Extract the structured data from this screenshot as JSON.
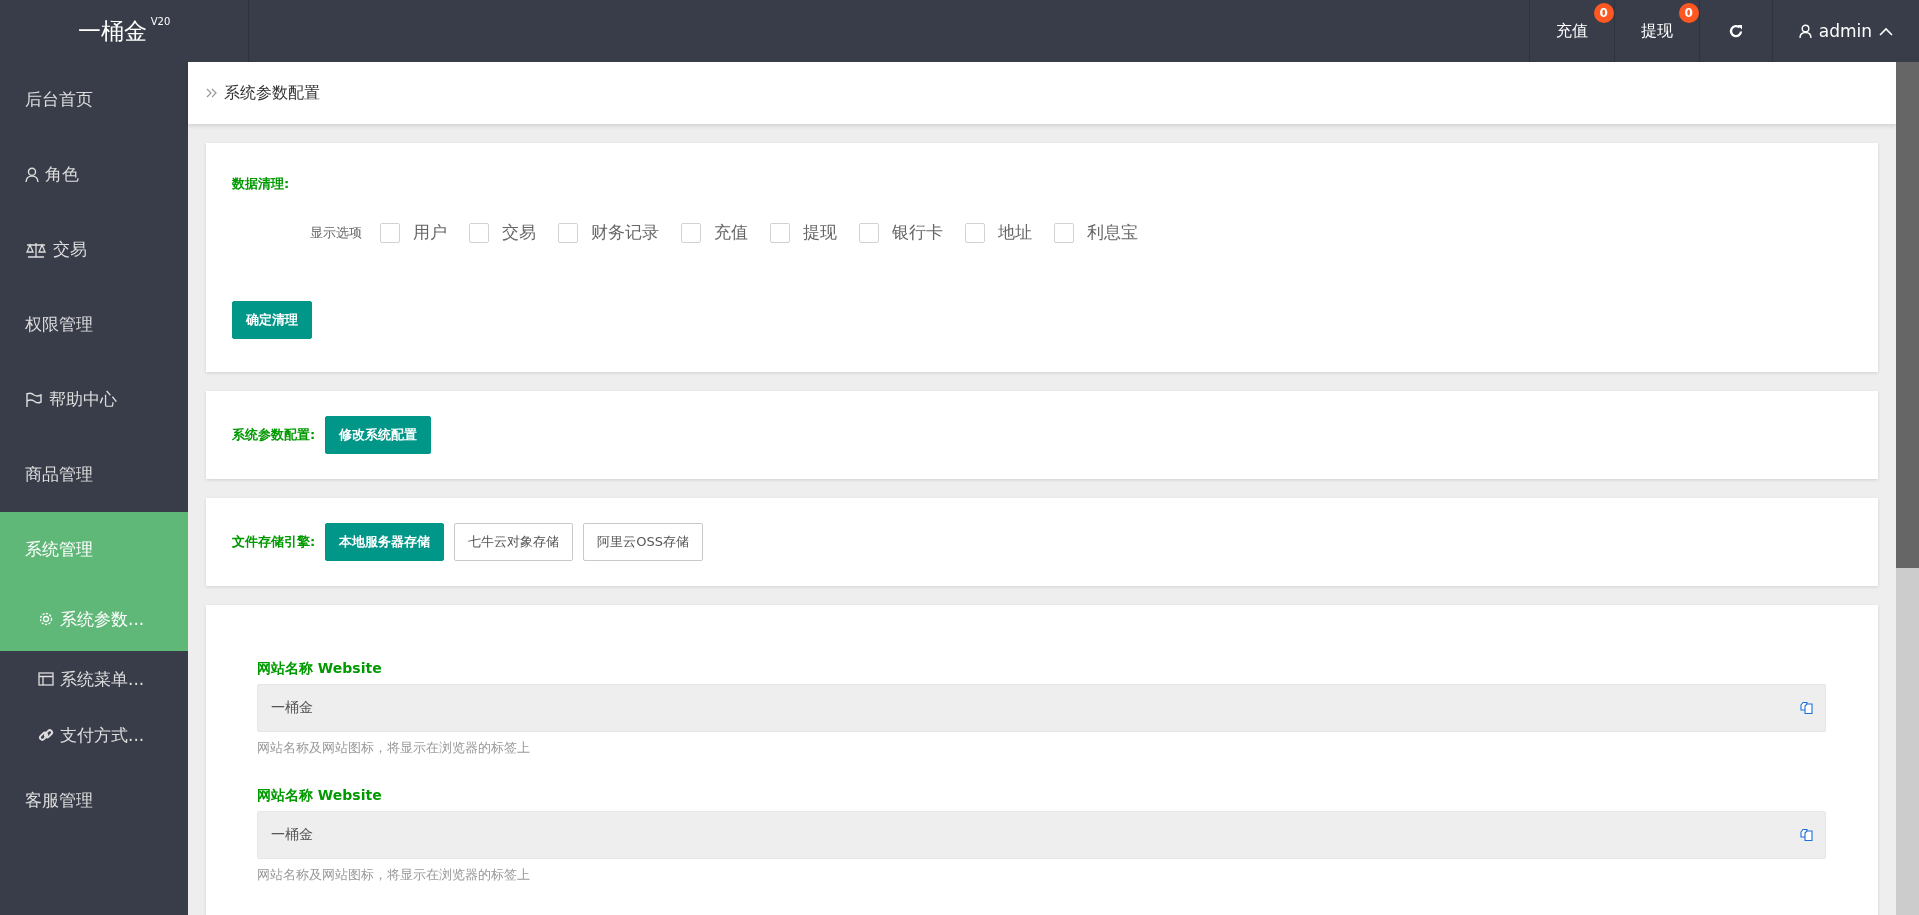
{
  "header": {
    "logo": "一桶金",
    "version": "V20",
    "actions": [
      {
        "kind": "badge",
        "label": "充值",
        "badge": "0"
      },
      {
        "kind": "badge",
        "label": "提现",
        "badge": "0"
      },
      {
        "kind": "refresh"
      }
    ],
    "user": {
      "name": "admin",
      "expanded": true
    }
  },
  "sidebar": {
    "items": [
      {
        "label": "后台首页",
        "kind": "plain",
        "selected": false
      },
      {
        "label": "角色",
        "kind": "user",
        "selected": false
      },
      {
        "label": "交易",
        "kind": "scale",
        "selected": false
      },
      {
        "label": "权限管理",
        "kind": "plain",
        "selected": false
      },
      {
        "label": "帮助中心",
        "kind": "flag",
        "selected": false
      },
      {
        "label": "商品管理",
        "kind": "plain",
        "selected": false
      },
      {
        "label": "系统管理",
        "kind": "plain",
        "selected": true,
        "expanded": true,
        "children": [
          {
            "label": "系统参数...",
            "kind": "gear",
            "selected": true
          },
          {
            "label": "系统菜单...",
            "kind": "window",
            "selected": false
          },
          {
            "label": "支付方式...",
            "kind": "link",
            "selected": false
          }
        ]
      },
      {
        "label": "客服管理",
        "kind": "plain",
        "selected": false
      }
    ]
  },
  "breadcrumb": "系统参数配置",
  "data_cleanup": {
    "title": "数据清理:",
    "options_label": "显示选项",
    "options": [
      {
        "label": "用户",
        "checked": false
      },
      {
        "label": "交易",
        "checked": false
      },
      {
        "label": "财务记录",
        "checked": false
      },
      {
        "label": "充值",
        "checked": false
      },
      {
        "label": "提现",
        "checked": false
      },
      {
        "label": "银行卡",
        "checked": false
      },
      {
        "label": "地址",
        "checked": false
      },
      {
        "label": "利息宝",
        "checked": false
      }
    ],
    "button": "确定清理"
  },
  "system_config": {
    "title": "系统参数配置:",
    "button": "修改系统配置"
  },
  "storage": {
    "title": "文件存储引擎:",
    "options": [
      {
        "label": "本地服务器存储",
        "selected": true
      },
      {
        "label": "七牛云对象存储",
        "selected": false
      },
      {
        "label": "阿里云OSS存储",
        "selected": false
      }
    ]
  },
  "fields": [
    {
      "label": "网站名称 Website",
      "value": "一桶金",
      "hint": "网站名称及网站图标，将显示在浏览器的标签上"
    },
    {
      "label": "网站名称 Website",
      "value": "一桶金",
      "hint": "网站名称及网站图标，将显示在浏览器的标签上"
    }
  ]
}
